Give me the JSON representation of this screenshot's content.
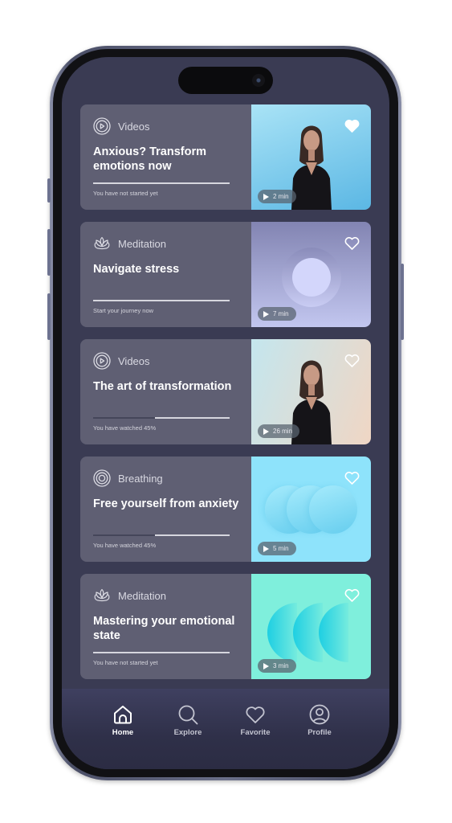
{
  "cards": [
    {
      "category": "Videos",
      "category_icon": "play-circle-icon",
      "title": "Anxious? Transform emotions now",
      "status": "You have not started yet",
      "progress_percent": 0,
      "duration": "2 min",
      "favorited": true,
      "thumbnail": "person-video",
      "thumb_colors": [
        "#a9e3f6",
        "#5bb7e4"
      ]
    },
    {
      "category": "Meditation",
      "category_icon": "lotus-icon",
      "title": "Navigate stress",
      "status": "Start your journey now",
      "progress_percent": 0,
      "duration": "7 min",
      "favorited": false,
      "thumbnail": "circle-meditation",
      "thumb_colors": [
        "#8284b2",
        "#c2c6ef"
      ]
    },
    {
      "category": "Videos",
      "category_icon": "play-circle-icon",
      "title": "The art of transformation",
      "status": "You have watched 45%",
      "progress_percent": 45,
      "duration": "26 min",
      "favorited": false,
      "thumbnail": "person-video",
      "thumb_colors": [
        "#c4e6ee",
        "#f0d6c4"
      ]
    },
    {
      "category": "Breathing",
      "category_icon": "concentric-circles-icon",
      "title": "Free yourself from anxiety",
      "status": "You have watched 45%",
      "progress_percent": 45,
      "duration": "5 min",
      "favorited": false,
      "thumbnail": "breathing-circles",
      "thumb_colors": [
        "#8ee3fb",
        "#6fd0f1"
      ]
    },
    {
      "category": "Meditation",
      "category_icon": "lotus-icon",
      "title": "Mastering your emotional state",
      "status": "You have not started yet",
      "progress_percent": 0,
      "duration": "3 min",
      "favorited": false,
      "thumbnail": "half-circles",
      "thumb_colors": [
        "#7fefdc",
        "#22cfe0"
      ]
    }
  ],
  "tabbar": {
    "active": "Home",
    "items": [
      {
        "label": "Home",
        "icon": "home-icon"
      },
      {
        "label": "Explore",
        "icon": "search-icon"
      },
      {
        "label": "Favorite",
        "icon": "heart-icon"
      },
      {
        "label": "Profile",
        "icon": "profile-icon"
      }
    ]
  },
  "colors": {
    "screen_bg": "#3a3b53",
    "card_bg": "#5f5f73",
    "tab_active": "#ffffff",
    "tab_inactive": "#c3c4d0"
  }
}
